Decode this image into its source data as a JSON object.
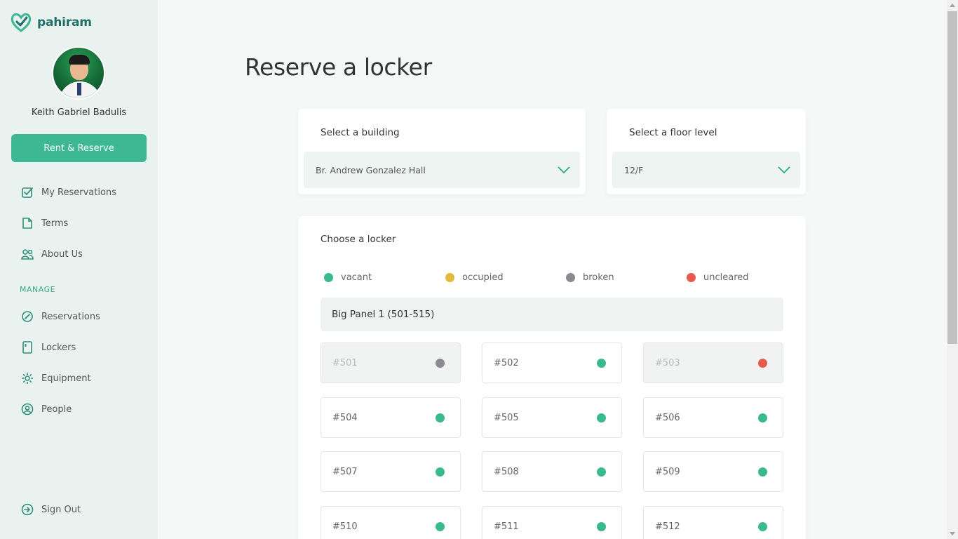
{
  "app": {
    "name": "pahiram"
  },
  "user": {
    "name": "Keith Gabriel Badulis"
  },
  "sidebar": {
    "cta_label": "Rent & Reserve",
    "items": [
      {
        "label": "My Reservations",
        "icon": "check-icon"
      },
      {
        "label": "Terms",
        "icon": "document-icon"
      },
      {
        "label": "About Us",
        "icon": "users-icon"
      }
    ],
    "manage_label": "MANAGE",
    "manage_items": [
      {
        "label": "Reservations",
        "icon": "pen-icon"
      },
      {
        "label": "Lockers",
        "icon": "locker-icon"
      },
      {
        "label": "Equipment",
        "icon": "gear-icon"
      },
      {
        "label": "People",
        "icon": "person-icon"
      }
    ],
    "sign_out": "Sign Out"
  },
  "main": {
    "title": "Reserve a locker",
    "building": {
      "label": "Select a building",
      "value": "Br. Andrew Gonzalez Hall"
    },
    "floor": {
      "label": "Select a floor level",
      "value": "12/F"
    },
    "lockers": {
      "label": "Choose a locker",
      "legend": [
        {
          "label": "vacant",
          "color": "#3aba8a"
        },
        {
          "label": "occupied",
          "color": "#e2b93b"
        },
        {
          "label": "broken",
          "color": "#8a8a90"
        },
        {
          "label": "uncleared",
          "color": "#e85b4a"
        }
      ],
      "panel": "Big Panel 1 (501-515)",
      "items": [
        {
          "id": "#501",
          "status": "broken"
        },
        {
          "id": "#502",
          "status": "vacant"
        },
        {
          "id": "#503",
          "status": "uncleared"
        },
        {
          "id": "#504",
          "status": "vacant"
        },
        {
          "id": "#505",
          "status": "vacant"
        },
        {
          "id": "#506",
          "status": "vacant"
        },
        {
          "id": "#507",
          "status": "vacant"
        },
        {
          "id": "#508",
          "status": "vacant"
        },
        {
          "id": "#509",
          "status": "vacant"
        },
        {
          "id": "#510",
          "status": "vacant"
        },
        {
          "id": "#511",
          "status": "vacant"
        },
        {
          "id": "#512",
          "status": "vacant"
        }
      ]
    }
  },
  "colors": {
    "accent": "#3db892",
    "brand": "#1f6f6a",
    "sidebar_bg": "#eaf2ef"
  }
}
